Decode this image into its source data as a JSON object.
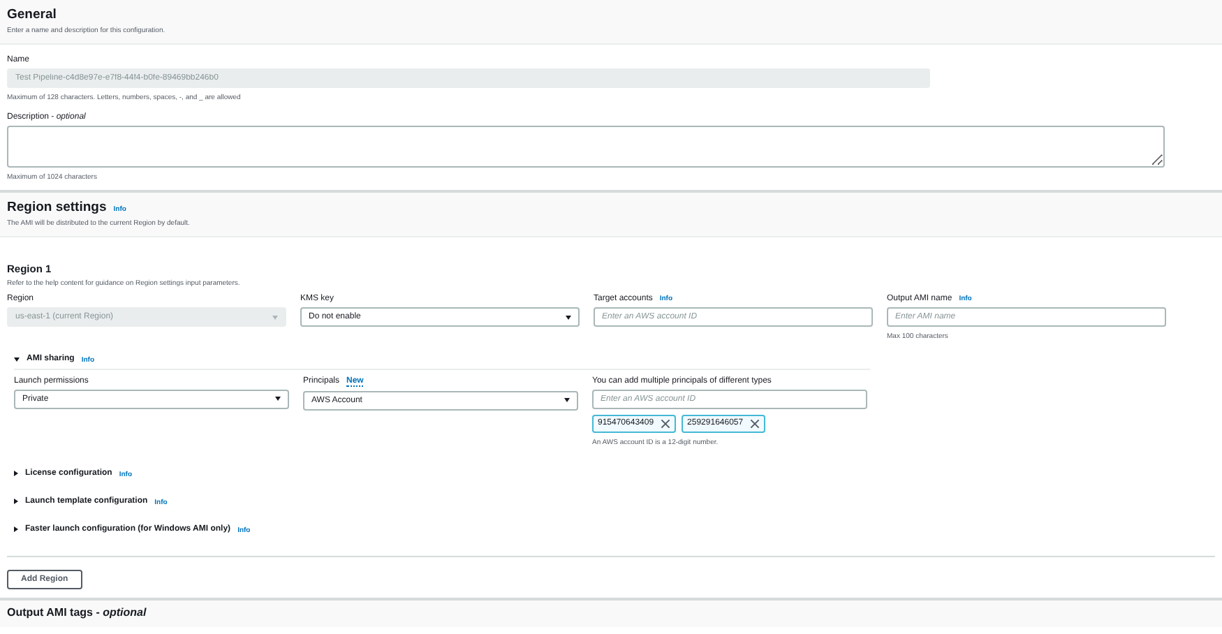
{
  "general": {
    "title": "General",
    "description": "Enter a name and description for this configuration.",
    "fields": [
      {
        "kind": "input",
        "label": "Name",
        "value": "Test Pipeline-c4d8e97e-e7f8-44f4-b0fe-89469bb246b0",
        "disabled": true,
        "hint": "Maximum of 128 characters. Letters, numbers, spaces, -, and _ are allowed"
      },
      {
        "kind": "textarea",
        "label": "Description - *optional*",
        "hint": "Maximum of 1024 characters"
      }
    ]
  },
  "region_settings": {
    "title": "Region settings",
    "info": "Info",
    "description": "The AMI will be distributed to the current Region by default.",
    "region": {
      "title": "Region 1",
      "description": "Refer to the help content for guidance on Region settings input parameters.",
      "fields": [
        {
          "kind": "select",
          "label": "Region",
          "value": "us-east-1 (current Region)",
          "disabled": true
        },
        {
          "kind": "select",
          "label": "KMS key",
          "value": "Do not enable",
          "disabled": false
        },
        {
          "kind": "input",
          "label": "Target accounts",
          "info": "Info",
          "placeholder": "Enter an AWS account ID"
        },
        {
          "kind": "input",
          "label": "Output AMI name",
          "info": "Info",
          "placeholder": "Enter AMI name",
          "hint": "Max 100 characters"
        }
      ],
      "ami_sharing": {
        "title": "AMI sharing",
        "info": "Info",
        "expanded": true,
        "fields": [
          {
            "kind": "select",
            "label": "Launch permissions",
            "value": "Private",
            "disabled": false
          },
          {
            "kind": "select",
            "label": "Principals",
            "badge": "New",
            "value": "AWS Account",
            "disabled": false
          },
          {
            "kind": "tokens",
            "label": "You can add multiple principals of different types",
            "placeholder": "Enter an AWS account ID",
            "tokens": [
              "915470643409",
              "259291646057"
            ],
            "hint": "An AWS account ID is a 12-digit number."
          }
        ]
      },
      "expanders": [
        {
          "title": "License configuration",
          "info": "Info",
          "expanded": false
        },
        {
          "title": "Launch template configuration",
          "info": "Info",
          "expanded": false
        },
        {
          "title": "Faster launch configuration (for Windows AMI only)",
          "info": "Info",
          "expanded": false
        }
      ]
    },
    "add_button": "Add Region"
  },
  "next_section": {
    "title": "Output AMI tags - *optional*"
  }
}
